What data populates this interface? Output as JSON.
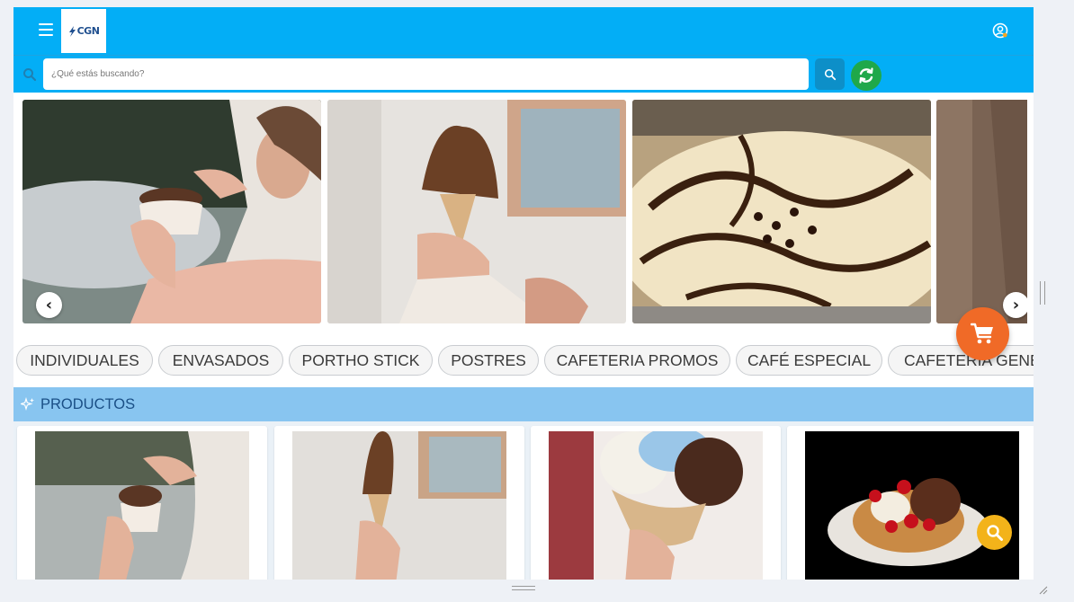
{
  "header": {
    "logo_text": "CGN",
    "icons": {
      "menu": "hamburger-menu-icon",
      "user": "user-account-icon"
    },
    "brand_color": "#03aef6"
  },
  "search": {
    "placeholder": "¿Qué estás buscando?",
    "value": "",
    "icons": {
      "lead": "search-icon",
      "button": "search-icon",
      "sync": "refresh-sync-icon"
    },
    "sync_color": "#1fa84a"
  },
  "carousel": {
    "prev_label": "‹",
    "next_label": "›",
    "slides": [
      {
        "subject": "woman eating chocolate ice cream from cup"
      },
      {
        "subject": "hand holding chocolate ice cream cone"
      },
      {
        "subject": "vanilla soft serve with chocolate sauce"
      },
      {
        "subject": "partial image"
      }
    ]
  },
  "categories": [
    "INDIVIDUALES",
    "ENVASADOS",
    "PORTHO STICK",
    "POSTRES",
    "CAFETERIA PROMOS",
    "CAFÉ ESPECIAL",
    "CAFETERIA GENERAL"
  ],
  "products": {
    "title": "PRODUCTOS",
    "title_icon": "sparkle-icon",
    "items": [
      {
        "subject": "ice cream cup"
      },
      {
        "subject": "chocolate cone"
      },
      {
        "subject": "double scoop cone"
      },
      {
        "subject": "ice cream sundae basket"
      }
    ]
  },
  "fabs": {
    "cart_icon": "shopping-cart-icon",
    "cart_color": "#f06a27",
    "zoom_icon": "magnifier-icon",
    "zoom_color": "#f3b31a"
  }
}
